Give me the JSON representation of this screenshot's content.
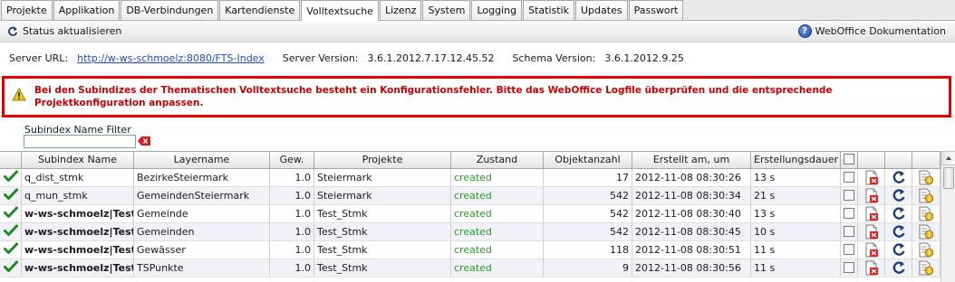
{
  "tabs": [
    {
      "label": "Projekte",
      "active": false
    },
    {
      "label": "Applikation",
      "active": false
    },
    {
      "label": "DB-Verbindungen",
      "active": false
    },
    {
      "label": "Kartendienste",
      "active": false
    },
    {
      "label": "Volltextsuche",
      "active": true
    },
    {
      "label": "Lizenz",
      "active": false
    },
    {
      "label": "System",
      "active": false
    },
    {
      "label": "Logging",
      "active": false
    },
    {
      "label": "Statistik",
      "active": false
    },
    {
      "label": "Updates",
      "active": false
    },
    {
      "label": "Passwort",
      "active": false
    }
  ],
  "toolbar": {
    "refresh_label": "Status aktualisieren",
    "doc_label": "WebOffice Dokumentation",
    "refresh_icon": "refresh-icon",
    "doc_icon": "help-icon"
  },
  "info": {
    "server_url_label": "Server URL:",
    "server_url": "http://w-ws-schmoelz:8080/FTS-Index",
    "server_version_label": "Server Version:",
    "server_version": "3.6.1.2012.7.17.12.45.52",
    "schema_version_label": "Schema Version:",
    "schema_version": "3.6.1.2012.9.25"
  },
  "error": {
    "message": "Bei den Subindizes der Thematischen Volltextsuche besteht ein Konfigurationsfehler. Bitte das WebOffice Logfile überprüfen und die entsprechende Projektkonfiguration anpassen.",
    "color": "#c80000"
  },
  "filter": {
    "label": "Subindex Name Filter",
    "value": ""
  },
  "table": {
    "columns": [
      "Subindex Name",
      "Layername",
      "Gew.",
      "Projekte",
      "Zustand",
      "Objektanzahl",
      "Erstellt am, um",
      "Erstellungsdauer"
    ],
    "rows": [
      {
        "name": "q_dist_stmk",
        "bold": false,
        "layer": "BezirkeSteiermark",
        "gew": "1.0",
        "projekte": "Steiermark",
        "zustand": "created",
        "anzahl": "17",
        "erstellt": "2012-11-08 08:30:26",
        "dauer": "13 s"
      },
      {
        "name": "q_mun_stmk",
        "bold": false,
        "layer": "GemeindenSteiermark",
        "gew": "1.0",
        "projekte": "Steiermark",
        "zustand": "created",
        "anzahl": "542",
        "erstellt": "2012-11-08 08:30:34",
        "dauer": "21 s"
      },
      {
        "name": "w-ws-schmoelz|Test_",
        "bold": true,
        "layer": "Gemeinde",
        "gew": "1.0",
        "projekte": "Test_Stmk",
        "zustand": "created",
        "anzahl": "542",
        "erstellt": "2012-11-08 08:30:40",
        "dauer": "13 s"
      },
      {
        "name": "w-ws-schmoelz|Test_",
        "bold": true,
        "layer": "Gemeinden",
        "gew": "1.0",
        "projekte": "Test_Stmk",
        "zustand": "created",
        "anzahl": "542",
        "erstellt": "2012-11-08 08:30:45",
        "dauer": "10 s"
      },
      {
        "name": "w-ws-schmoelz|Test_",
        "bold": true,
        "layer": "Gewässer",
        "gew": "1.0",
        "projekte": "Test_Stmk",
        "zustand": "created",
        "anzahl": "118",
        "erstellt": "2012-11-08 08:30:51",
        "dauer": "11 s"
      },
      {
        "name": "w-ws-schmoelz|Test_",
        "bold": true,
        "layer": "TSPunkte",
        "gew": "1.0",
        "projekte": "Test_Stmk",
        "zustand": "created",
        "anzahl": "9",
        "erstellt": "2012-11-08 08:30:56",
        "dauer": "11 s"
      }
    ],
    "row_icons": [
      "ok-check-icon",
      "delete-icon",
      "refresh-icon",
      "info-icon"
    ]
  }
}
